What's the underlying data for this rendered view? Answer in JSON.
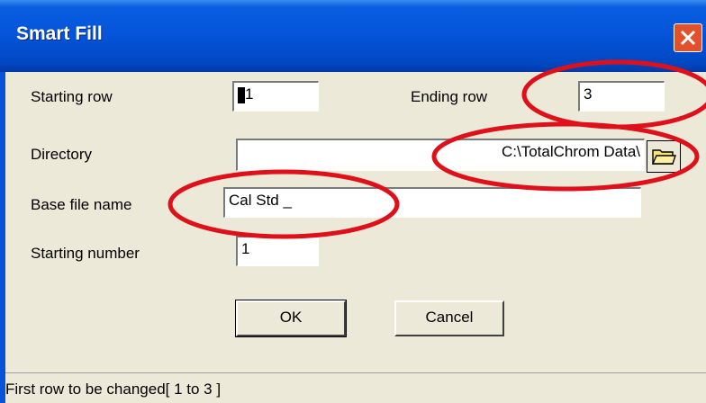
{
  "window": {
    "title": "Smart Fill"
  },
  "form": {
    "starting_row_label": "Starting row",
    "starting_row_value": "1",
    "ending_row_label": "Ending row",
    "ending_row_value": "3",
    "directory_label": "Directory",
    "directory_value": "C:\\TotalChrom Data\\",
    "base_file_name_label": "Base file name",
    "base_file_name_value": "Cal Std _",
    "starting_number_label": "Starting number",
    "starting_number_value": "1"
  },
  "buttons": {
    "ok_label": "OK",
    "cancel_label": "Cancel"
  },
  "status": {
    "text": "First row to be changed[ 1 to 3 ]"
  },
  "icons": {
    "close": "close-icon",
    "folder": "folder-icon"
  },
  "colors": {
    "title_bar": "#0553D8",
    "close_button": "#E2512C",
    "annotation": "#E0101A",
    "dialog_bg": "#ECE9D8"
  }
}
